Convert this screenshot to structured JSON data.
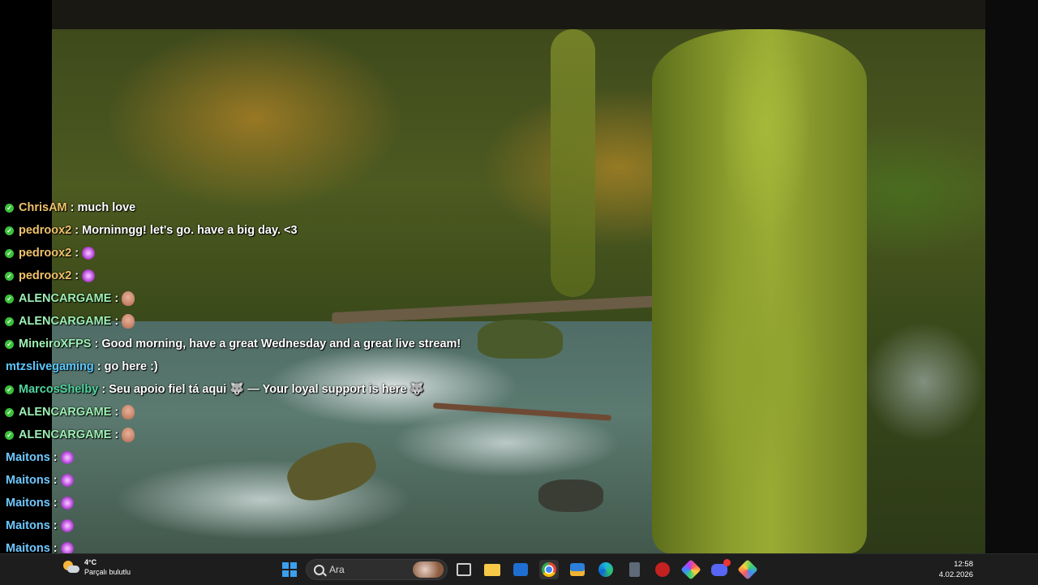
{
  "chat": {
    "messages": [
      {
        "user": "ChrisAM",
        "color": "#f0c26a",
        "badge": true,
        "text": " : much love",
        "emote": null
      },
      {
        "user": "pedroox2",
        "color": "#f0c26a",
        "badge": true,
        "text": " : Morninngg! let's go. have a big day. <3",
        "emote": null
      },
      {
        "user": "pedroox2",
        "color": "#f0c26a",
        "badge": true,
        "text": " :",
        "emote": "flower"
      },
      {
        "user": "pedroox2",
        "color": "#f0c26a",
        "badge": true,
        "text": " :",
        "emote": "flower"
      },
      {
        "user": "ALENCARGAME",
        "color": "#9ef0b4",
        "badge": true,
        "text": " :",
        "emote": "face"
      },
      {
        "user": "ALENCARGAME",
        "color": "#9ef0b4",
        "badge": true,
        "text": " :",
        "emote": "face"
      },
      {
        "user": "MineiroXFPS",
        "color": "#9ef0b4",
        "badge": true,
        "text": " : Good morning, have a great Wednesday and a great live stream!",
        "emote": null
      },
      {
        "user": "mtzslivegaming",
        "color": "#5cc8ff",
        "badge": false,
        "text": " : go here :)",
        "emote": null
      },
      {
        "user": "MarcosShelby",
        "color": "#4fd6a0",
        "badge": true,
        "text": " : Seu apoio fiel tá aqui 🐺 — Your loyal support is here 🐺",
        "emote": null
      },
      {
        "user": "ALENCARGAME",
        "color": "#9ef0b4",
        "badge": true,
        "text": " :",
        "emote": "face"
      },
      {
        "user": "ALENCARGAME",
        "color": "#9ef0b4",
        "badge": true,
        "text": " :",
        "emote": "face"
      },
      {
        "user": "Maitons",
        "color": "#6ec8ff",
        "badge": false,
        "text": " :",
        "emote": "flower"
      },
      {
        "user": "Maitons",
        "color": "#6ec8ff",
        "badge": false,
        "text": " :",
        "emote": "flower"
      },
      {
        "user": "Maitons",
        "color": "#6ec8ff",
        "badge": false,
        "text": " :",
        "emote": "flower"
      },
      {
        "user": "Maitons",
        "color": "#6ec8ff",
        "badge": false,
        "text": " :",
        "emote": "flower"
      },
      {
        "user": "Maitons",
        "color": "#6ec8ff",
        "badge": false,
        "text": " :",
        "emote": "flower"
      }
    ]
  },
  "taskbar": {
    "weather": {
      "temp": "4°C",
      "condition": "Parçalı bulutlu",
      "icon": "partly-cloudy-icon"
    },
    "search": {
      "placeholder": "Ara"
    },
    "clock": {
      "time": "12:58",
      "date": "4.02.2026"
    },
    "apps": [
      "start-icon",
      "task-view-icon",
      "file-explorer-icon",
      "outlook-icon",
      "chrome-icon",
      "store-icon",
      "edge-icon",
      "calculator-icon",
      "red-app-icon",
      "gem-app-icon",
      "discord-icon",
      "gem-app-2-icon"
    ]
  }
}
